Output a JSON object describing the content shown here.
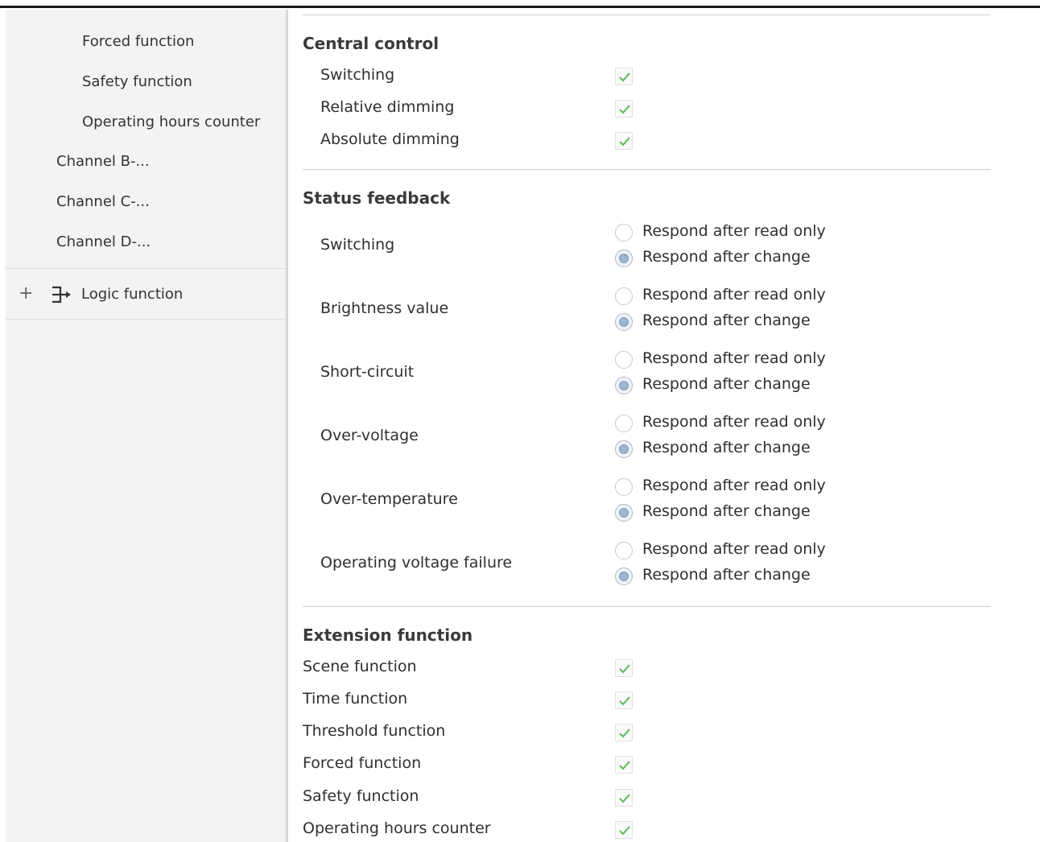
{
  "sidebar": {
    "sub_items": [
      "Forced function",
      "Safety function",
      "Operating hours counter"
    ],
    "channels": [
      "Channel B-...",
      "Channel C-...",
      "Channel D-..."
    ],
    "logic": {
      "expand_symbol": "+",
      "label": "Logic function"
    }
  },
  "central_control": {
    "title": "Central control",
    "items": [
      {
        "label": "Switching",
        "checked": true
      },
      {
        "label": "Relative dimming",
        "checked": true
      },
      {
        "label": "Absolute dimming",
        "checked": true
      }
    ]
  },
  "status_feedback": {
    "title": "Status feedback",
    "option_read": "Respond after read only",
    "option_change": "Respond after change",
    "items": [
      {
        "label": "Switching",
        "selected": "Respond after change"
      },
      {
        "label": "Brightness value",
        "selected": "Respond after change"
      },
      {
        "label": "Short-circuit",
        "selected": "Respond after change"
      },
      {
        "label": "Over-voltage",
        "selected": "Respond after change"
      },
      {
        "label": "Over-temperature",
        "selected": "Respond after change"
      },
      {
        "label": "Operating voltage failure",
        "selected": "Respond after change"
      }
    ]
  },
  "extension_function": {
    "title": "Extension function",
    "items": [
      {
        "label": "Scene function",
        "checked": true
      },
      {
        "label": "Time function",
        "checked": true
      },
      {
        "label": "Threshold function",
        "checked": true
      },
      {
        "label": "Forced function",
        "checked": true
      },
      {
        "label": "Safety function",
        "checked": true
      },
      {
        "label": "Operating hours counter",
        "checked": true
      }
    ]
  },
  "colors": {
    "check": "#5cb85c",
    "radio_selected": "#9fb6d1",
    "sidebar_bg": "#f3f3f3"
  }
}
